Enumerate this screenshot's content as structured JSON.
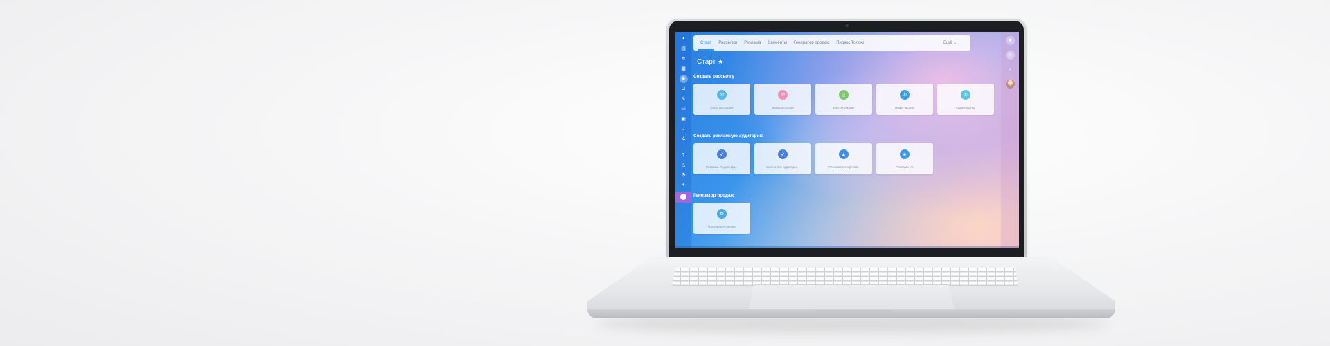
{
  "nav": {
    "tabs": [
      "Старт",
      "Рассылки",
      "Реклама",
      "Сегменты",
      "Генератор продаж",
      "Яндекс.Толока"
    ],
    "more_label": "Ещё ⌄"
  },
  "page": {
    "title": "Старт",
    "star_icon": "★"
  },
  "sections": {
    "mailing": {
      "title": "Создать рассылку",
      "cards": [
        {
          "label": "Email рассылка",
          "icon": "email-icon",
          "color": "#56b7e8"
        },
        {
          "label": "SMS рассылка",
          "icon": "sms-icon",
          "color": "#f28fb3"
        },
        {
          "label": "Мессенджеры",
          "icon": "messenger-icon",
          "color": "#7cc96b"
        },
        {
          "label": "Инфо-звонок",
          "icon": "phone-icon",
          "color": "#3aa0e6"
        },
        {
          "label": "Аудио-звонок",
          "icon": "audio-call-icon",
          "color": "#5cc6e0"
        }
      ]
    },
    "ads": {
      "title": "Создать рекламную аудиторию",
      "cards": [
        {
          "label": "Реклама Яндекс.Ди...",
          "icon": "yandex-direct-icon",
          "color": "#4a7fe0"
        },
        {
          "label": "Look-a-like аудитори...",
          "icon": "lookalike-icon",
          "color": "#4a7fe0"
        },
        {
          "label": "Реклама Google Ads",
          "icon": "google-ads-icon",
          "color": "#3b8de8"
        },
        {
          "label": "Реклама VK",
          "icon": "vk-ads-icon",
          "color": "#3b9be8"
        }
      ]
    },
    "sales": {
      "title": "Генератор продаж",
      "cards": [
        {
          "label": "Повторные сделки",
          "icon": "repeat-deals-icon",
          "color": "#4fa9e0"
        }
      ]
    }
  }
}
